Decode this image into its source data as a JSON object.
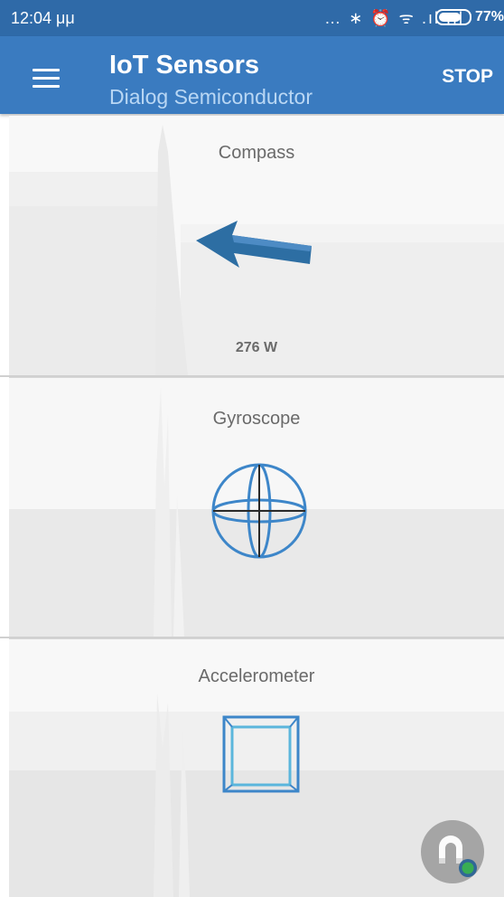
{
  "status_bar": {
    "time": "12:04 μμ",
    "indicators": "… ∗ ⏰ ᯤ .ıl .ıl",
    "battery": "77%"
  },
  "app_bar": {
    "title": "IoT Sensors",
    "subtitle": "Dialog Semiconductor",
    "action_label": "STOP",
    "menu_icon": "menu-icon"
  },
  "sensors": {
    "compass": {
      "title": "Compass",
      "heading": "276 W"
    },
    "gyroscope": {
      "title": "Gyroscope"
    },
    "accelerometer": {
      "title": "Accelerometer"
    }
  },
  "fab": {
    "icon": "magnet-icon",
    "status_color": "#27a745"
  },
  "colors": {
    "status_bar": "#2f6aa8",
    "app_bar": "#3a7bc0",
    "accent_3d": "#3d86c9",
    "arrow": "#2d6ea3"
  }
}
